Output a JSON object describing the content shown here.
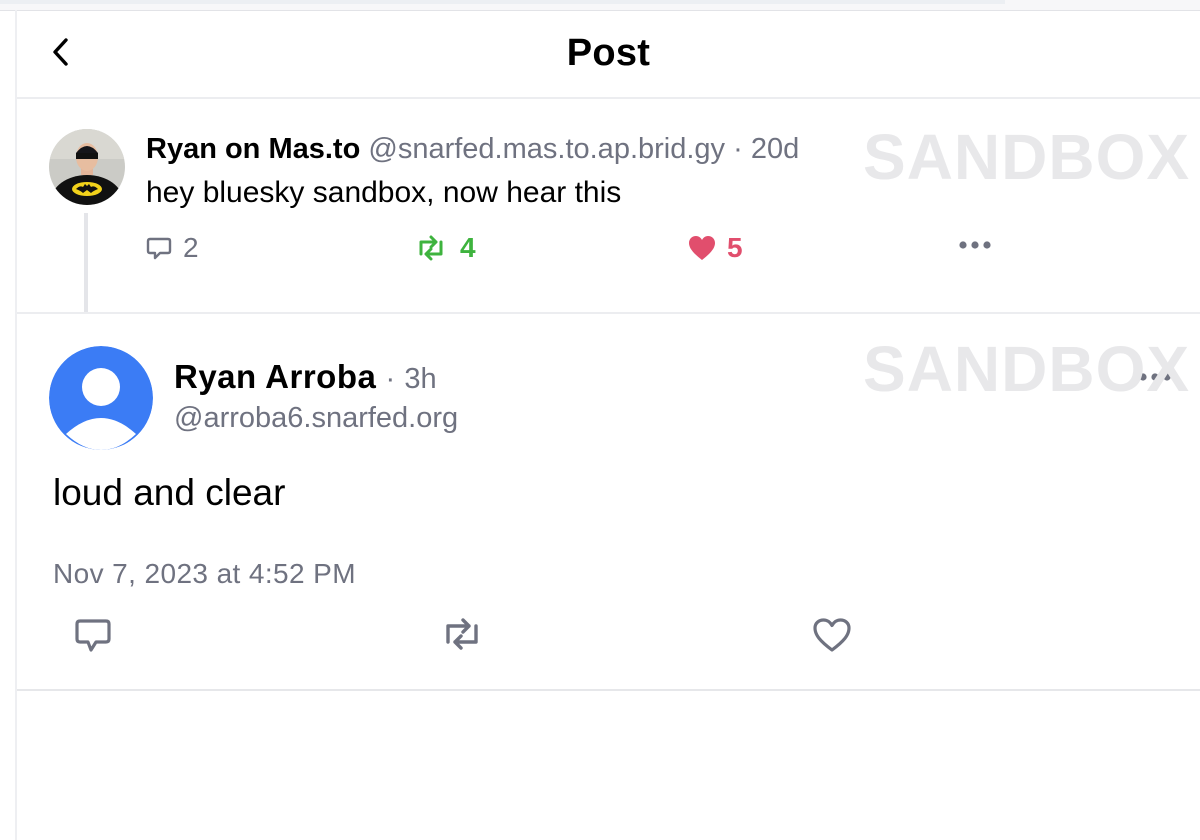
{
  "header": {
    "title": "Post",
    "back_icon": "chevron-left-icon"
  },
  "parent_post": {
    "author_name": "Ryan on Mas.to",
    "handle": "@snarfed.mas.to.ap.brid.gy",
    "separator": "·",
    "time": "20d",
    "text": "hey bluesky sandbox, now hear this",
    "reply_count": "2",
    "repost_count": "4",
    "like_count": "5",
    "colors": {
      "repost": "#3eb33e",
      "like": "#e14e6d"
    }
  },
  "watermark": "SANDBOX",
  "main_post": {
    "author_name": "Ryan Arroba",
    "separator": "·",
    "time": "3h",
    "handle": "@arroba6.snarfed.org",
    "text": "loud and clear",
    "timestamp": "Nov 7, 2023 at 4:52 PM",
    "avatar_color": "#3b7cf5"
  }
}
